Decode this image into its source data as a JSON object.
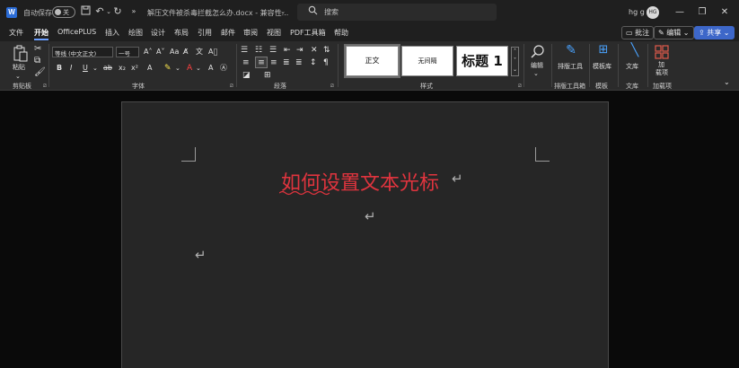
{
  "titlebar": {
    "logo": "W",
    "autosave_label": "自动保存",
    "autosave_state": "关",
    "doc_title": "解压文件被杀毒拦截怎么办.docx - 兼容性...",
    "search_placeholder": "搜索",
    "user_name": "hg g",
    "avatar_initials": "HG",
    "icons": [
      "save-icon",
      "undo-icon",
      "redo-icon",
      "more-icon",
      "search-icon",
      "minimize-icon",
      "restore-icon",
      "close-icon"
    ]
  },
  "menubar": {
    "items": [
      "文件",
      "开始",
      "OfficePLUS",
      "插入",
      "绘图",
      "设计",
      "布局",
      "引用",
      "邮件",
      "审阅",
      "视图",
      "PDF工具箱",
      "帮助"
    ],
    "active": "开始",
    "comment_btn": "批注",
    "edit_btn": "编辑",
    "share_btn": "共享"
  },
  "ribbon": {
    "clipboard": {
      "paste_label": "粘贴",
      "group_label": "剪贴板"
    },
    "font": {
      "font_name": "等线 (中文正文)",
      "font_size": "一号",
      "group_label": "字体"
    },
    "paragraph": {
      "group_label": "段落"
    },
    "styles": {
      "items": [
        "正文",
        "无间隔",
        "标题 1"
      ],
      "group_label": "样式"
    },
    "editing": {
      "label": "编辑"
    },
    "layout_tool": {
      "label": "排版工具",
      "group_label": "排版工具箱"
    },
    "template": {
      "label": "模板库",
      "group_label": "模板"
    },
    "library": {
      "label": "文库",
      "group_label": "文库"
    },
    "addin": {
      "label_line1": "加",
      "label_line2": "载项",
      "group_label": "加载项"
    }
  },
  "document": {
    "heading": "如何设置文本光标",
    "heading_color": "#e0343e",
    "paragraph_mark": "↵"
  }
}
